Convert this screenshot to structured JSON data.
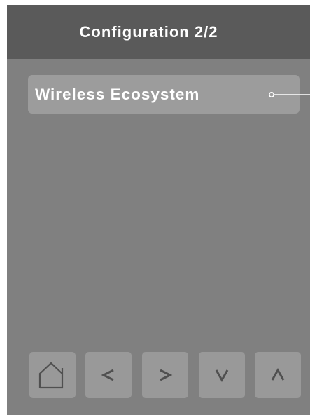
{
  "header": {
    "title": "Configuration 2/2"
  },
  "menu": {
    "items": [
      {
        "label": "Wireless Ecosystem"
      }
    ]
  },
  "nav": {
    "buttons": [
      {
        "icon": "home-icon"
      },
      {
        "icon": "chevron-left-icon"
      },
      {
        "icon": "chevron-right-icon"
      },
      {
        "icon": "chevron-down-icon"
      },
      {
        "icon": "chevron-up-icon"
      }
    ]
  },
  "colors": {
    "screen_bg": "#808080",
    "header_bg": "#5a5a5a",
    "item_bg": "#9c9c9c",
    "button_bg": "#999999",
    "text": "#ffffff",
    "icon_stroke": "#505050"
  }
}
